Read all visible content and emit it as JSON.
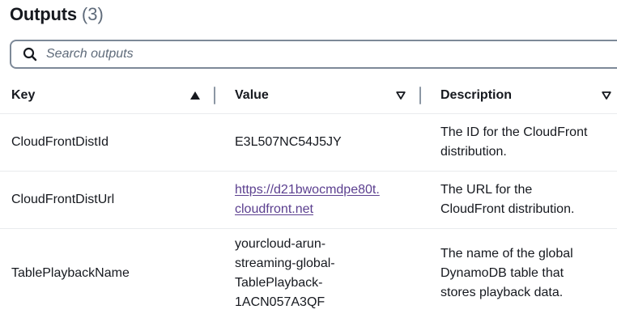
{
  "header": {
    "title": "Outputs",
    "count": "(3)"
  },
  "search": {
    "placeholder": "Search outputs",
    "value": "",
    "icon": "search-icon"
  },
  "table": {
    "columns": [
      {
        "label": "Key",
        "sort": "ascending"
      },
      {
        "label": "Value",
        "sort": "none"
      },
      {
        "label": "Description",
        "sort": "none"
      }
    ],
    "rows": [
      {
        "key": "CloudFrontDistId",
        "value_lines": [
          "E3L507NC54J5JY"
        ],
        "value_is_link": false,
        "description_lines": [
          "The ID for the CloudFront",
          "distribution."
        ]
      },
      {
        "key": "CloudFrontDistUrl",
        "value_lines": [
          "https://d21bwocmdpe80t.",
          "cloudfront.net"
        ],
        "value_is_link": true,
        "description_lines": [
          "The URL for the",
          "CloudFront distribution."
        ]
      },
      {
        "key": "TablePlaybackName",
        "value_lines": [
          "yourcloud-arun-",
          "streaming-global-",
          "TablePlayback-",
          "1ACN057A3QF"
        ],
        "value_is_link": false,
        "description_lines": [
          "The name of the global",
          "DynamoDB table that",
          "stores playback data."
        ]
      }
    ]
  },
  "colors": {
    "text": "#16191f",
    "muted": "#5f6b7a",
    "link_visited": "#5b3f8f",
    "border": "#7d8998",
    "row_divider": "#e9ebed"
  }
}
